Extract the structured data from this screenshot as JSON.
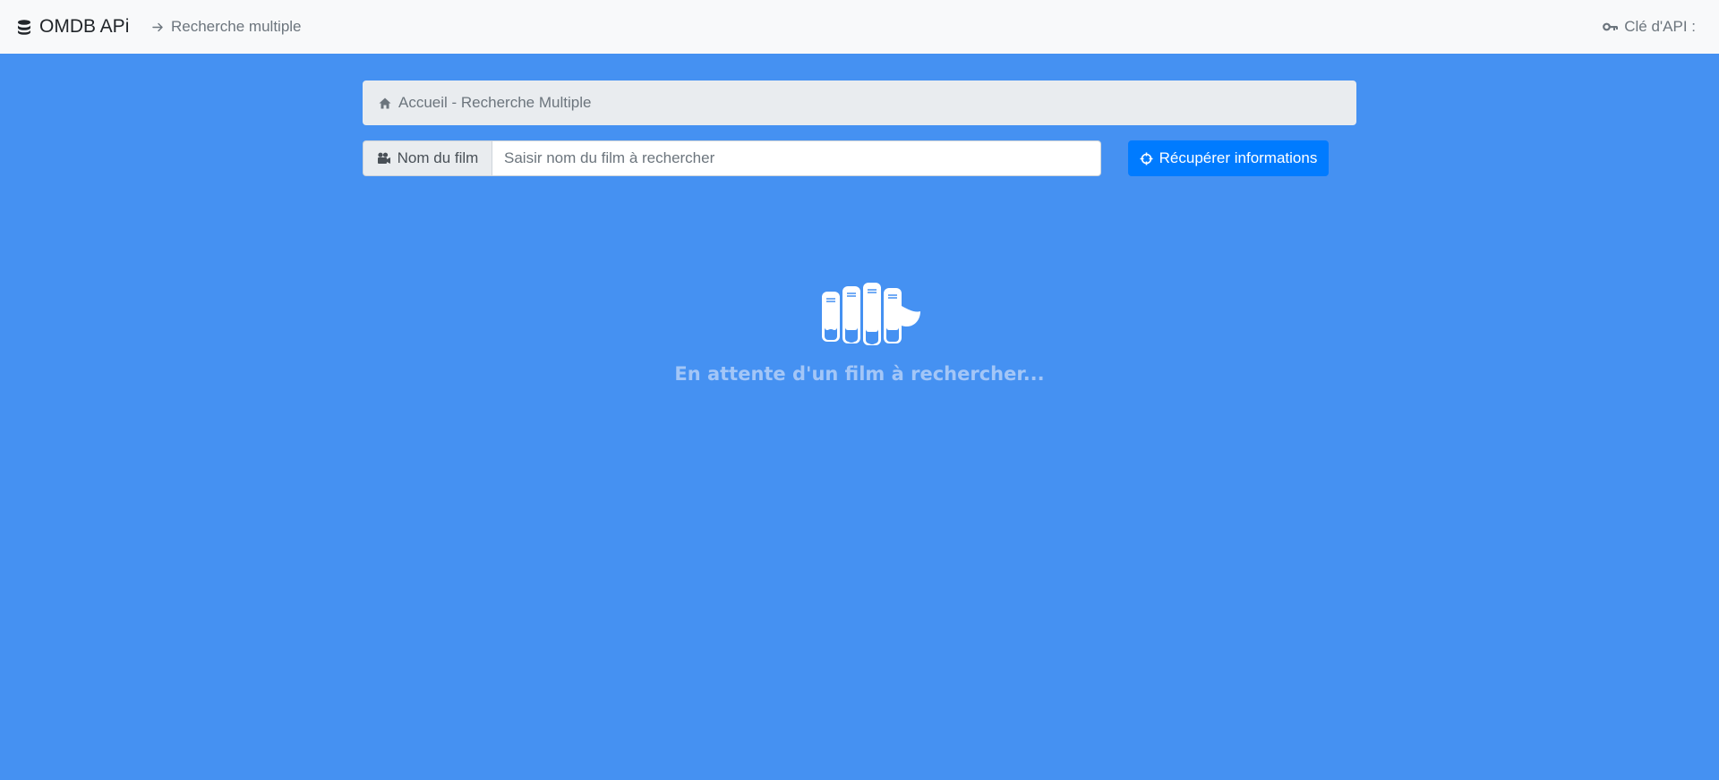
{
  "navbar": {
    "brand_label": "OMDB APi",
    "brand_icon": "database-icon",
    "link_label": "Recherche multiple",
    "link_icon": "arrow-right-icon",
    "api_key_label": "Clé d'API :",
    "api_key_icon": "key-icon"
  },
  "breadcrumb": {
    "icon": "home-icon",
    "label": "Accueil - Recherche Multiple"
  },
  "search": {
    "prepend_label": "Nom du film",
    "prepend_icon": "video-camera-icon",
    "value": "",
    "placeholder": "Saisir nom du film à rechercher",
    "button_label": "Récupérer informations",
    "button_icon": "crosshairs-icon"
  },
  "empty_state": {
    "icon": "film-rolls-icon",
    "message": "En attente d'un film à rechercher..."
  },
  "colors": {
    "page_background": "#4591f2",
    "navbar_background": "#f8f9fa",
    "primary_button": "#007bff",
    "breadcrumb_background": "#e9ecef",
    "empty_text": "#a3c6f7"
  }
}
